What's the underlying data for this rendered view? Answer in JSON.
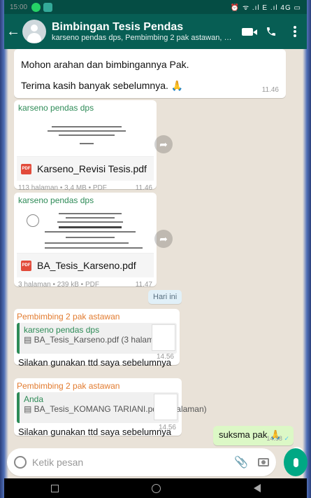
{
  "statusbar": {
    "time": "15:00",
    "right": "⏰ ᯤ .ıl E .ıl 4G ▭"
  },
  "header": {
    "title": "Bimbingan Tesis Pendas",
    "subtitle": "karseno pendas dps, Pembimbing 2 pak astawan, +62 857-3777..."
  },
  "messages": {
    "m1": {
      "line1": "Mohon arahan dan bimbingannya Pak.",
      "line2": "Terima kasih banyak sebelumnya. 🙏",
      "time": "11.46"
    },
    "doc1": {
      "sender": "karseno pendas dps",
      "filename": "Karseno_Revisi Tesis.pdf",
      "meta": "113 halaman • 3,4 MB • PDF",
      "time": "11.46"
    },
    "doc2": {
      "sender": "karseno pendas dps",
      "filename": "BA_Tesis_Karseno.pdf",
      "meta": "3 halaman • 239 kB • PDF",
      "time": "11.47"
    },
    "date_chip": "Hari ini",
    "reply1": {
      "sender": "Pembimbing 2 pak astawan",
      "quote_name": "karseno pendas dps",
      "quote_file": "▤ BA_Tesis_Karseno.pdf (3 halaman)",
      "text": "Silakan gunakan ttd saya sebelumnya",
      "time": "14.56"
    },
    "reply2": {
      "sender": "Pembimbing 2 pak astawan",
      "quote_name": "Anda",
      "quote_file": "▤ BA_Tesis_KOMANG TARIANI.pdf (2 halaman)",
      "text": "Silakan gunakan ttd saya sebelumnya",
      "time": "14.56"
    },
    "out1": {
      "text": "suksma pak 🙏",
      "time": "14.58",
      "ticks": "✓"
    }
  },
  "input": {
    "placeholder": "Ketik pesan"
  },
  "colors": {
    "header": "#075e54",
    "outgoing": "#dcf8c6",
    "accent": "#00a884"
  },
  "icons": {
    "back": "←",
    "forward": "➦",
    "attach": "📎",
    "scroll": "»"
  }
}
